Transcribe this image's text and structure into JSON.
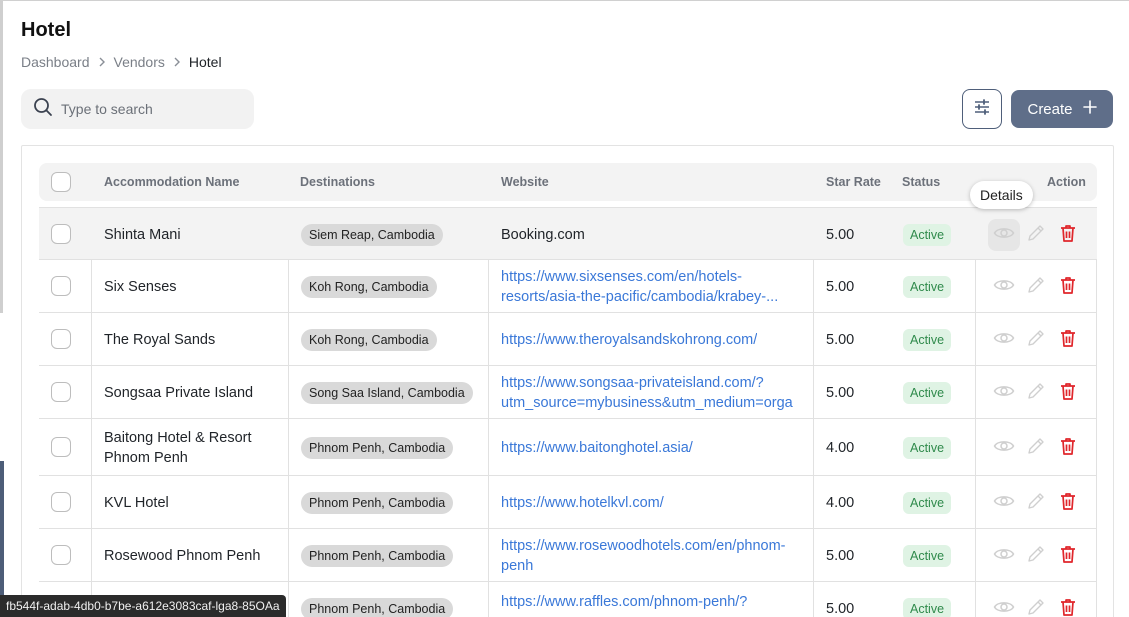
{
  "page": {
    "title": "Hotel"
  },
  "breadcrumb": [
    "Dashboard",
    "Vendors",
    "Hotel"
  ],
  "search": {
    "placeholder": "Type to search",
    "value": ""
  },
  "toolbar": {
    "create_label": "Create"
  },
  "table": {
    "headers": {
      "name": "Accommodation Name",
      "destinations": "Destinations",
      "website": "Website",
      "star_rate": "Star Rate",
      "status": "Status",
      "action": "Action"
    },
    "rows": [
      {
        "name": "Shinta Mani",
        "destination": "Siem Reap, Cambodia",
        "website": "Booking.com",
        "website_is_link": false,
        "star": "5.00",
        "status": "Active"
      },
      {
        "name": "Six Senses",
        "destination": "Koh Rong, Cambodia",
        "website": "https://www.sixsenses.com/en/hotels-resorts/asia-the-pacific/cambodia/krabey-island",
        "website_line1": "https://www.sixsenses.com/en/hotels-",
        "website_line2": "resorts/asia-the-pacific/cambodia/krabey-...",
        "star": "5.00",
        "status": "Active"
      },
      {
        "name": "The Royal Sands",
        "destination": "Koh Rong, Cambodia",
        "website": "https://www.theroyalsandskohrong.com/",
        "star": "5.00",
        "status": "Active"
      },
      {
        "name": "Songsaa Private Island",
        "destination": "Song Saa Island, Cambodia",
        "website": "https://www.songsaa-privateisland.com/?utm_source=mybusiness&utm_medium=organic",
        "website_line1": "https://www.songsaa-privateisland.com/?",
        "website_line2": "utm_source=mybusiness&utm_medium=orga",
        "star": "5.00",
        "status": "Active"
      },
      {
        "name_line1": "Baitong Hotel & Resort",
        "name_line2": "Phnom Penh",
        "destination": "Phnom Penh, Cambodia",
        "website": "https://www.baitonghotel.asia/",
        "star": "4.00",
        "status": "Active"
      },
      {
        "name": "KVL Hotel",
        "destination": "Phnom Penh, Cambodia",
        "website": "https://www.hotelkvl.com/",
        "star": "4.00",
        "status": "Active"
      },
      {
        "name": "Rosewood Phnom Penh",
        "destination": "Phnom Penh, Cambodia",
        "website_line1": "https://www.rosewoodhotels.com/en/phnom-",
        "website_line2": "penh",
        "star": "5.00",
        "status": "Active"
      },
      {
        "name": "",
        "destination": "Phnom Penh, Cambodia",
        "website_line1": "https://www.raffles.com/phnom-penh/?",
        "star": "5.00",
        "status": "Active"
      }
    ]
  },
  "tooltip": {
    "text": "Details"
  },
  "statusbar": {
    "text": "fb544f-adab-4db0-b7be-a612e3083caf-lga8-85OAa"
  },
  "colors": {
    "primary": "#5f6e89",
    "link": "#3a78d8",
    "danger": "#e0262b",
    "active_bg": "#dff3e4",
    "active_text": "#2f8a4b"
  }
}
